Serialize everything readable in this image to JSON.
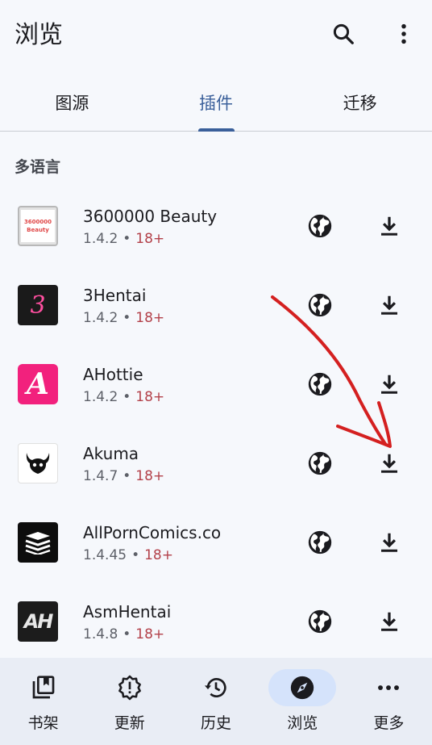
{
  "appbar": {
    "title": "浏览",
    "search_icon": "search-icon",
    "menu_icon": "more-vert-icon"
  },
  "tabs": [
    {
      "label": "图源",
      "active": false
    },
    {
      "label": "插件",
      "active": true
    },
    {
      "label": "迁移",
      "active": false
    }
  ],
  "section": {
    "header": "多语言"
  },
  "extensions": [
    {
      "name": "3600000 Beauty",
      "version": "1.4.2",
      "separator": "•",
      "nsfw": "18+",
      "logo": "3600000 Beauty"
    },
    {
      "name": "3Hentai",
      "version": "1.4.2",
      "separator": "•",
      "nsfw": "18+",
      "logo": "3"
    },
    {
      "name": "AHottie",
      "version": "1.4.2",
      "separator": "•",
      "nsfw": "18+",
      "logo": "A"
    },
    {
      "name": "Akuma",
      "version": "1.4.7",
      "separator": "•",
      "nsfw": "18+",
      "logo": "akuma"
    },
    {
      "name": "AllPornComics.co",
      "version": "1.4.45",
      "separator": "•",
      "nsfw": "18+",
      "logo": "books"
    },
    {
      "name": "AsmHentai",
      "version": "1.4.8",
      "separator": "•",
      "nsfw": "18+",
      "logo": "AH"
    }
  ],
  "bottom_nav": [
    {
      "label": "书架",
      "icon": "library-icon",
      "active": false
    },
    {
      "label": "更新",
      "icon": "updates-icon",
      "active": false
    },
    {
      "label": "历史",
      "icon": "history-icon",
      "active": false
    },
    {
      "label": "浏览",
      "icon": "compass-icon",
      "active": true
    },
    {
      "label": "更多",
      "icon": "more-horiz-icon",
      "active": false
    }
  ],
  "colors": {
    "accent": "#3a5f9a",
    "nsfw": "#b3414a",
    "annotation_arrow": "#d42020"
  }
}
